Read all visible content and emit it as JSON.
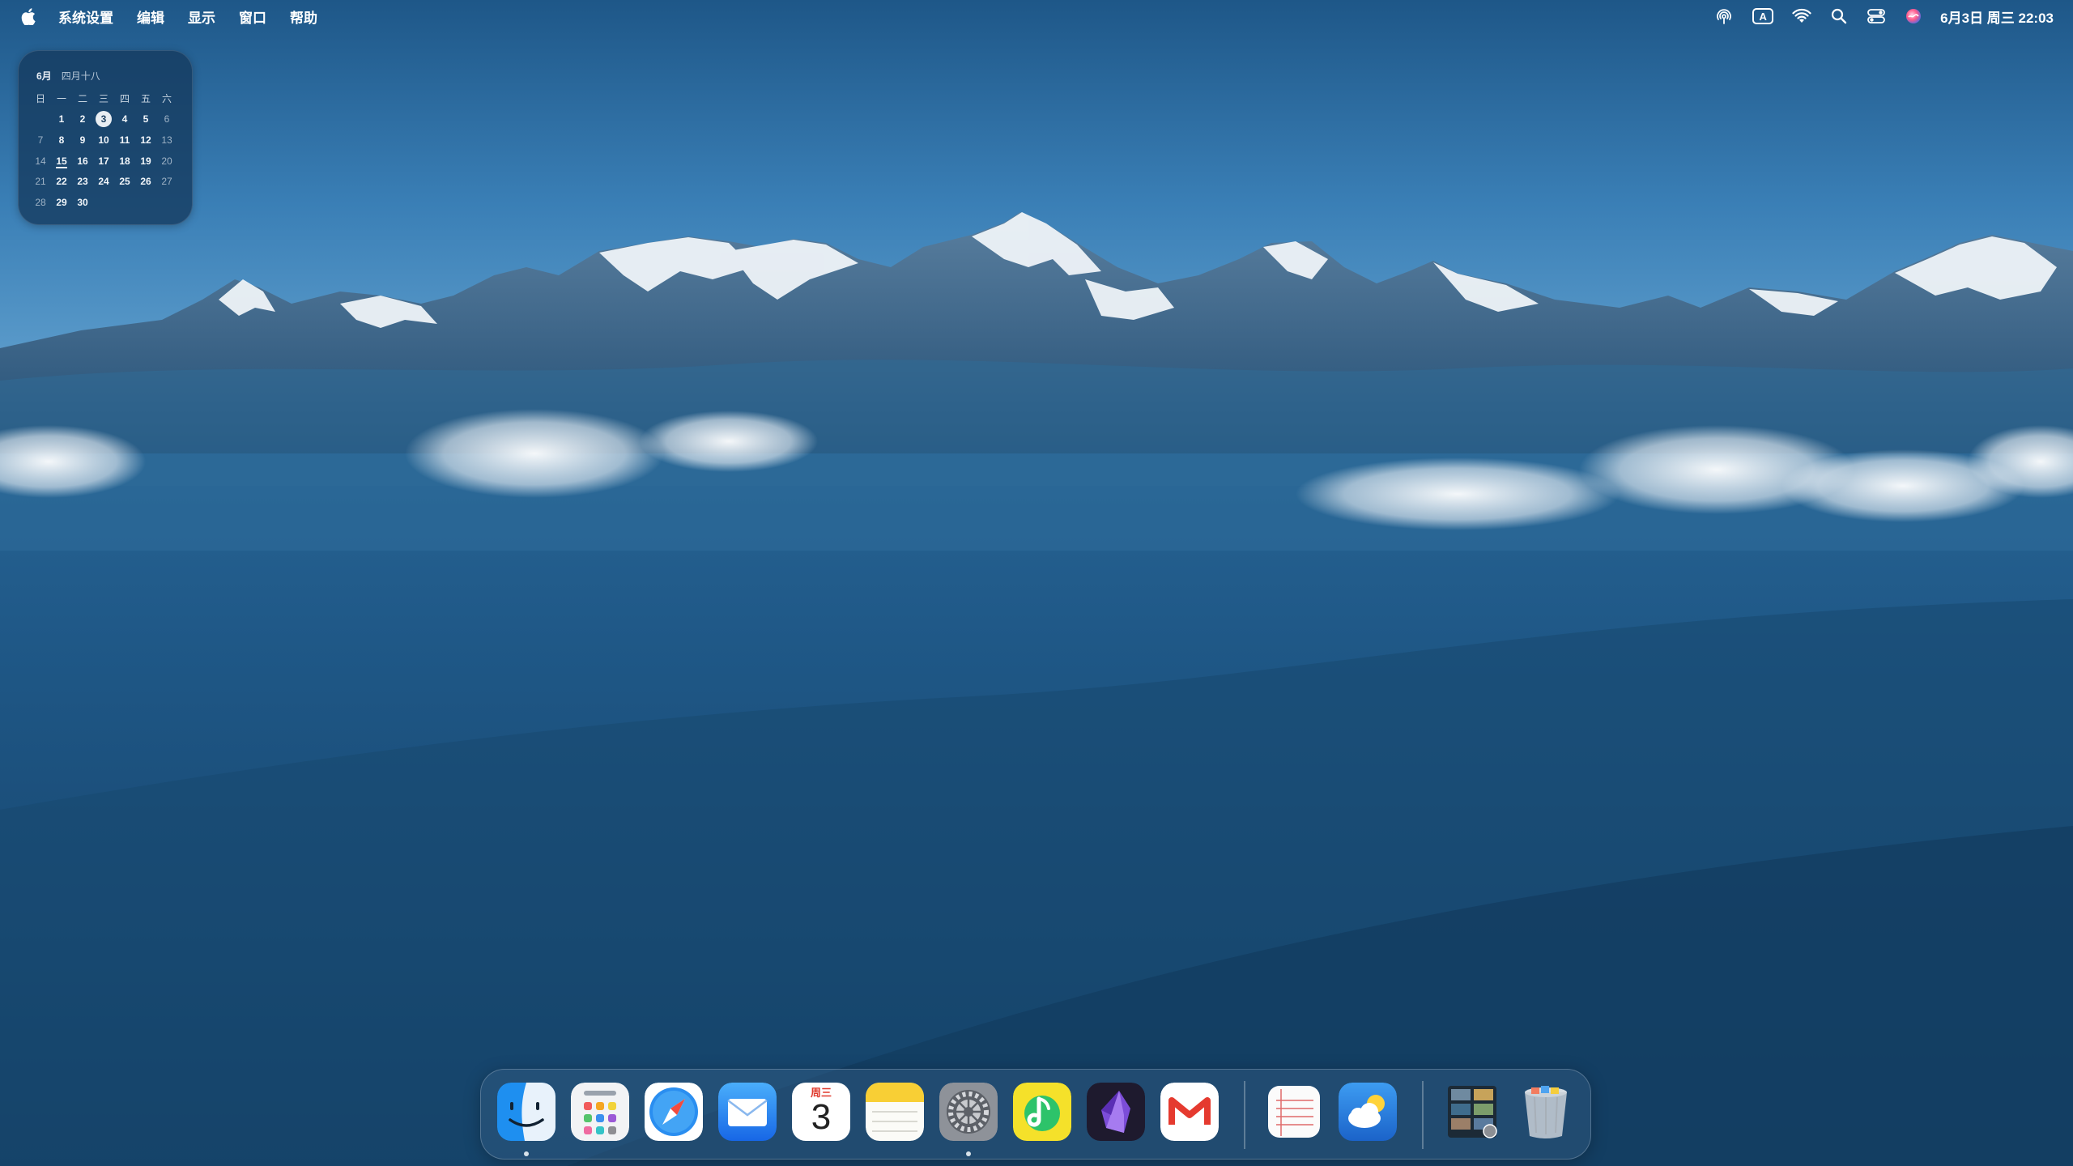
{
  "menubar": {
    "apple_icon": "apple-logo-icon",
    "items": [
      "系统设置",
      "编辑",
      "显示",
      "窗口",
      "帮助"
    ],
    "status_icons": [
      "airdrop-icon",
      "input-method-icon",
      "wifi-icon",
      "search-icon",
      "control-center-icon",
      "siri-icon"
    ],
    "input_method_label": "A",
    "clock": "6月3日 周三  22:03"
  },
  "calendar_widget": {
    "month": "6月",
    "lunar": "四月十八",
    "weekdays": [
      "日",
      "一",
      "二",
      "三",
      "四",
      "五",
      "六"
    ],
    "weeks": [
      [
        "",
        "1",
        "2",
        "3",
        "4",
        "5",
        "6"
      ],
      [
        "7",
        "8",
        "9",
        "10",
        "11",
        "12",
        "13"
      ],
      [
        "14",
        "15",
        "16",
        "17",
        "18",
        "19",
        "20"
      ],
      [
        "21",
        "22",
        "23",
        "24",
        "25",
        "26",
        "27"
      ],
      [
        "28",
        "29",
        "30",
        "",
        "",
        "",
        ""
      ]
    ],
    "today": "3"
  },
  "dock": {
    "apps": [
      {
        "name": "Finder",
        "icon": "finder-icon",
        "running": true
      },
      {
        "name": "Launchpad",
        "icon": "launchpad-icon",
        "running": false
      },
      {
        "name": "Safari",
        "icon": "safari-icon",
        "running": false
      },
      {
        "name": "Mail",
        "icon": "mail-icon",
        "running": false
      },
      {
        "name": "Calendar",
        "icon": "calendar-icon",
        "running": false,
        "weekday": "周三",
        "day": "3"
      },
      {
        "name": "Notes",
        "icon": "notes-icon",
        "running": false
      },
      {
        "name": "System Settings",
        "icon": "system-settings-icon",
        "running": true
      },
      {
        "name": "QQ Music",
        "icon": "qq-music-icon",
        "running": false
      },
      {
        "name": "Obsidian",
        "icon": "obsidian-icon",
        "running": false
      },
      {
        "name": "Gmail",
        "icon": "gmail-icon",
        "running": false
      }
    ],
    "recent": [
      {
        "name": "TextEdit",
        "icon": "textedit-icon"
      },
      {
        "name": "Weather",
        "icon": "weather-icon"
      }
    ],
    "others": [
      {
        "name": "Downloads stack",
        "icon": "downloads-stack-icon"
      },
      {
        "name": "Trash",
        "icon": "trash-icon"
      }
    ]
  },
  "colors": {
    "sky_top": "#1f5a8f",
    "sky_horizon": "#4a8fc4",
    "haze": "#2d6a99",
    "valley": "#153f66"
  }
}
